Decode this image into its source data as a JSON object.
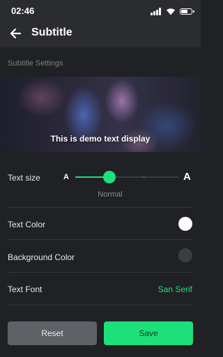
{
  "status_bar": {
    "time": "02:46",
    "icons": [
      "signal-icon",
      "wifi-icon",
      "battery-icon"
    ]
  },
  "app_bar": {
    "back_icon": "arrow-left-icon",
    "title": "Subtitle"
  },
  "section": {
    "heading": "Subtitle Settings"
  },
  "preview": {
    "demo_text": "This is demo text display"
  },
  "text_size": {
    "label": "Text size",
    "small_glyph": "A",
    "large_glyph": "A",
    "caption": "Normal",
    "level_fraction": 0.33,
    "accent_color": "#1ee07a"
  },
  "text_color": {
    "label": "Text Color",
    "value_color": "#ffffff"
  },
  "background_color": {
    "label": "Background Color",
    "value_color": "#3c3e42"
  },
  "text_font": {
    "label": "Text Font",
    "value": "San Serif"
  },
  "actions": {
    "reset_label": "Reset",
    "save_label": "Save"
  }
}
